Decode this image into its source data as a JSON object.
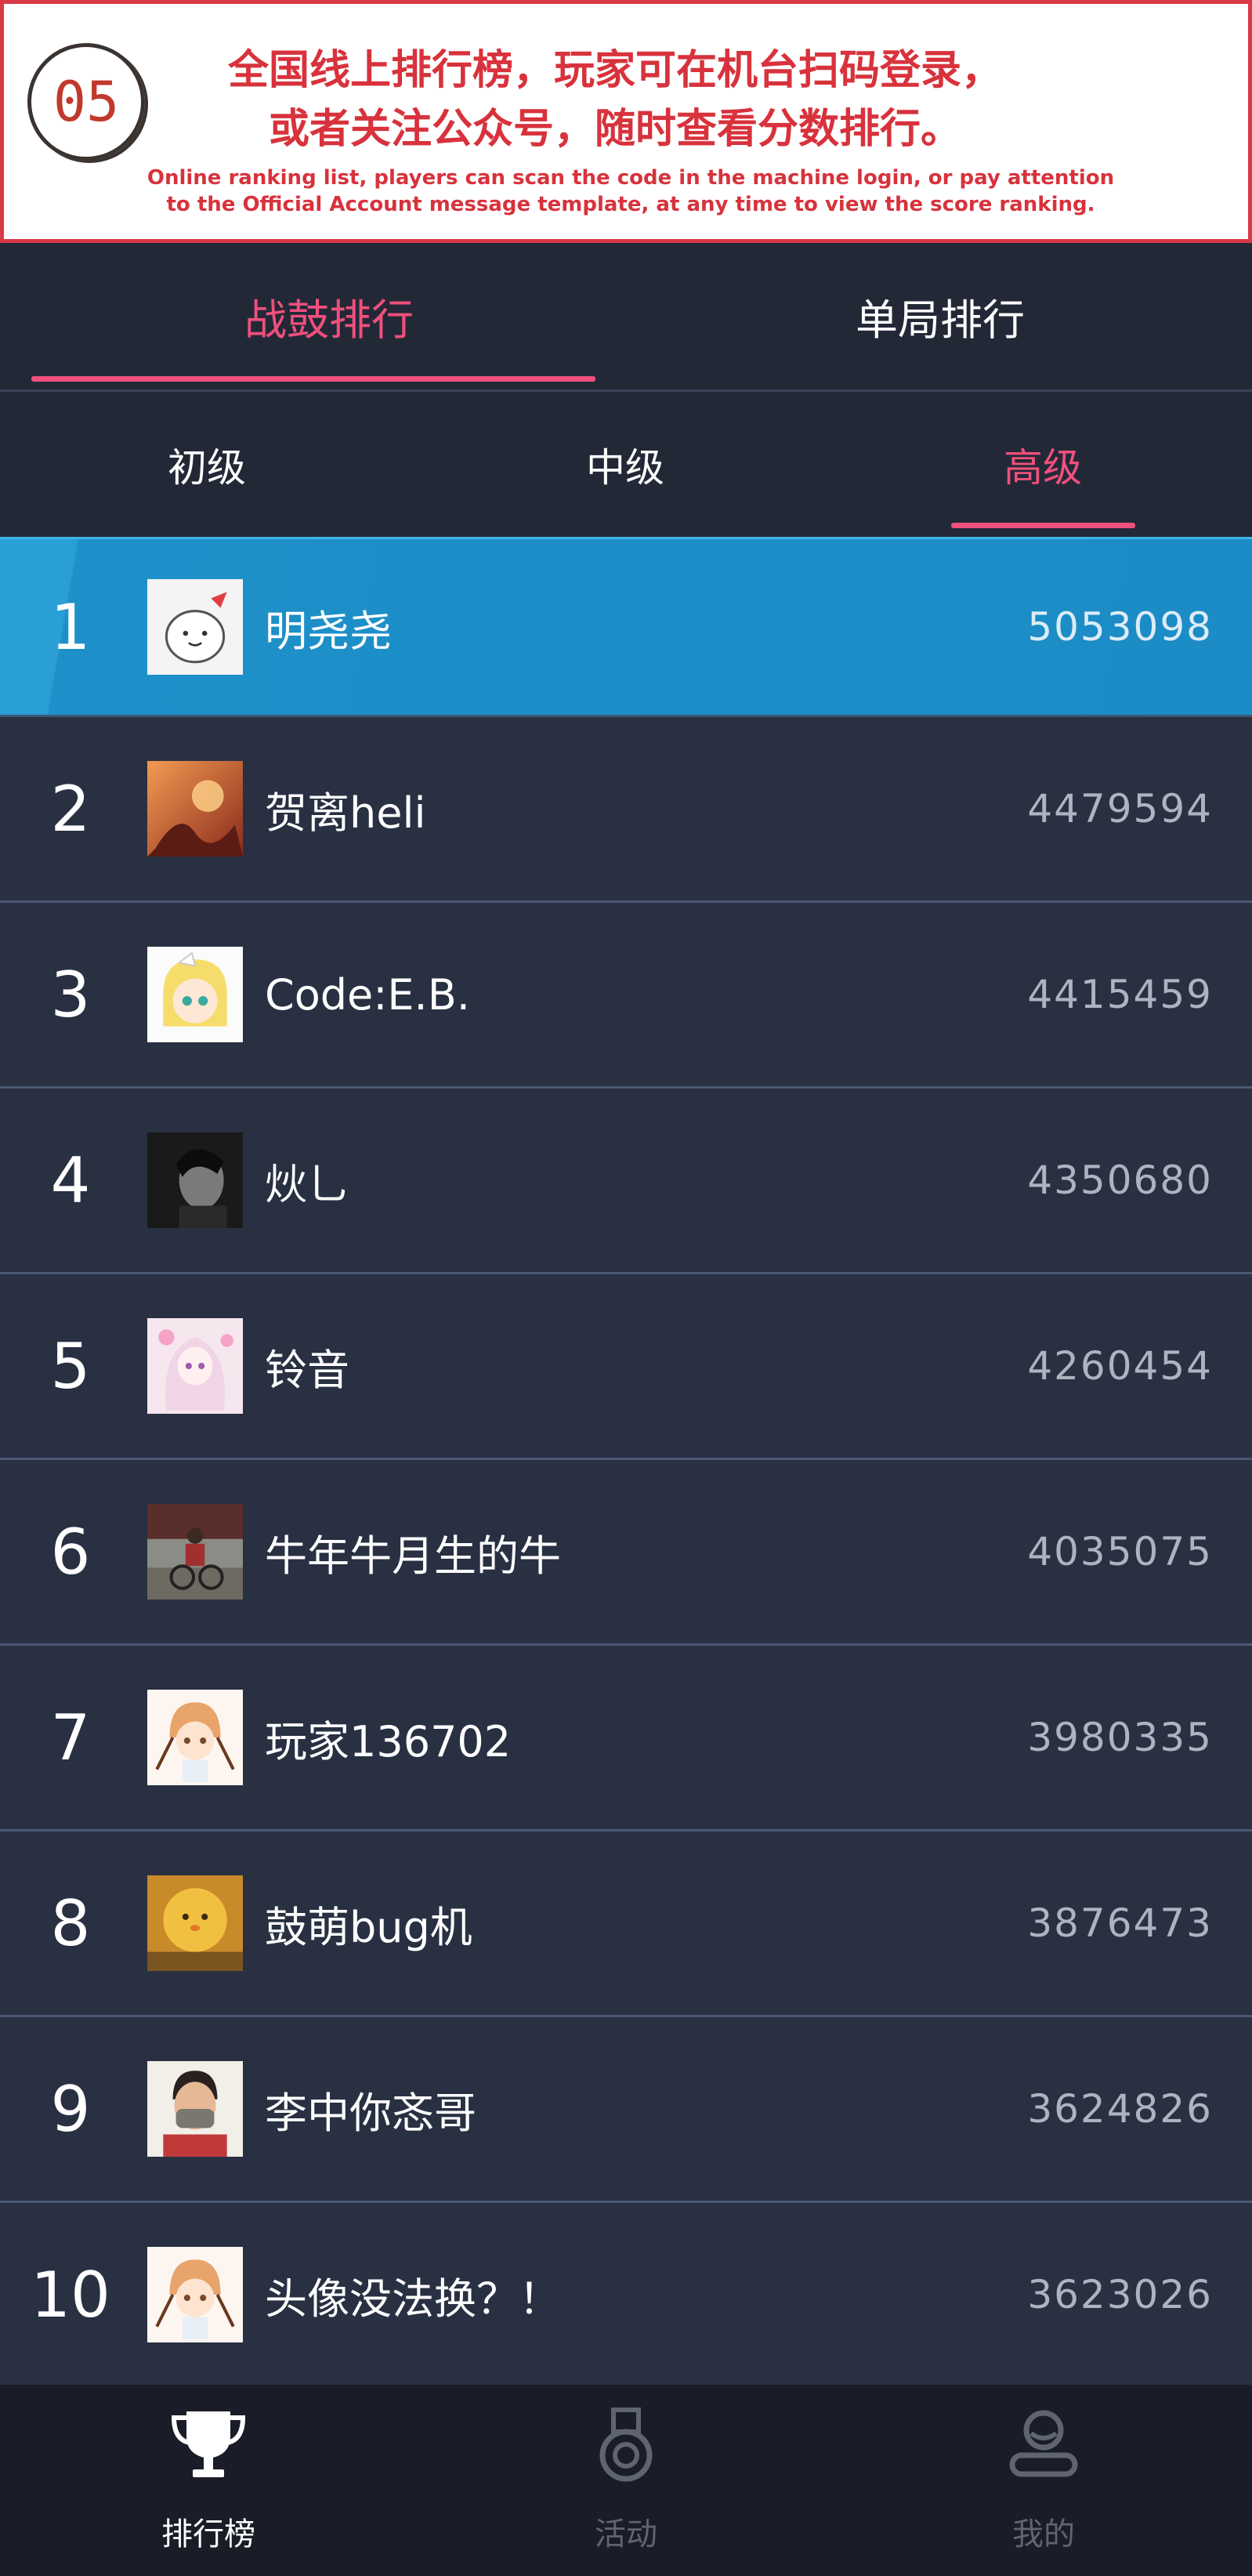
{
  "banner": {
    "badge": "05",
    "cn_line1": "全国线上排行榜，玩家可在机台扫码登录，",
    "cn_line2": "或者关注公众号，随时查看分数排行。",
    "en_line1": "Online ranking list, players can scan the code in the machine login, or pay attention",
    "en_line2": "to the Official Account message template, at any time to view the score ranking."
  },
  "main_tabs": [
    {
      "label": "战鼓排行",
      "active": true
    },
    {
      "label": "单局排行",
      "active": false
    }
  ],
  "level_tabs": [
    {
      "label": "初级",
      "active": false
    },
    {
      "label": "中级",
      "active": false
    },
    {
      "label": "高级",
      "active": true
    }
  ],
  "rankings": [
    {
      "rank": "1",
      "name": "明尧尧",
      "score": "5053098",
      "avatar": "cartoon-bun-avatar"
    },
    {
      "rank": "2",
      "name": "贺离heli",
      "score": "4479594",
      "avatar": "anime-orange-avatar"
    },
    {
      "rank": "3",
      "name": "Code:E.B.",
      "score": "4415459",
      "avatar": "blonde-anime-girl-avatar"
    },
    {
      "rank": "4",
      "name": "炏乚",
      "score": "4350680",
      "avatar": "dark-portrait-avatar"
    },
    {
      "rank": "5",
      "name": "铃音",
      "score": "4260454",
      "avatar": "pink-anime-girl-avatar"
    },
    {
      "rank": "6",
      "name": "牛年牛月生的牛",
      "score": "4035075",
      "avatar": "cyclist-photo-avatar"
    },
    {
      "rank": "7",
      "name": "玩家136702",
      "score": "3980335",
      "avatar": "chibi-drummer-avatar"
    },
    {
      "rank": "8",
      "name": "鼓萌bug机",
      "score": "3876473",
      "avatar": "yellow-fluffy-avatar"
    },
    {
      "rank": "9",
      "name": "李中你忞哥",
      "score": "3624826",
      "avatar": "masked-person-avatar"
    },
    {
      "rank": "10",
      "name": "头像没法换？！",
      "score": "3623026",
      "avatar": "chibi-drummer-avatar"
    }
  ],
  "bottom_nav": [
    {
      "label": "排行榜",
      "icon": "trophy-icon",
      "active": true
    },
    {
      "label": "活动",
      "icon": "medal-icon",
      "active": false
    },
    {
      "label": "我的",
      "icon": "user-icon",
      "active": false
    }
  ],
  "colors": {
    "accent": "#f0507c",
    "banner_red": "#d8323c",
    "highlight_row": "#1b8cc6",
    "row_bg": "#283042"
  }
}
